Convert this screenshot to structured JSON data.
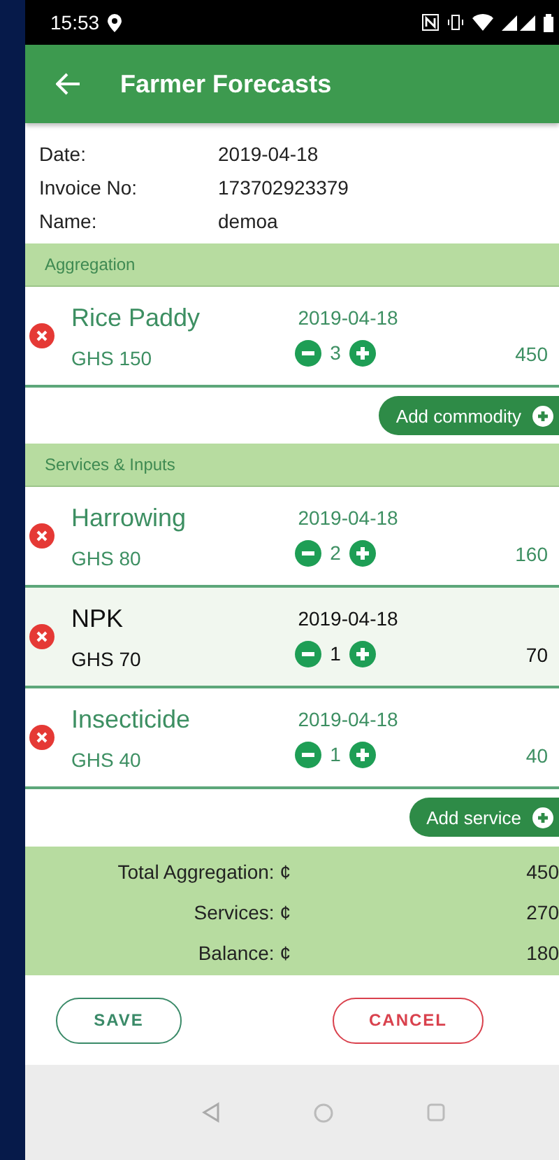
{
  "status_bar": {
    "time": "15:53"
  },
  "app_bar": {
    "title": "Farmer Forecasts"
  },
  "info": [
    {
      "label": "Date:",
      "value": "2019-04-18"
    },
    {
      "label": "Invoice No:",
      "value": "173702923379"
    },
    {
      "label": "Name:",
      "value": "demoa"
    }
  ],
  "aggregation": {
    "header": "Aggregation",
    "items": [
      {
        "name": "Rice Paddy",
        "price": "GHS 150",
        "date": "2019-04-18",
        "quantity": "3",
        "amount": "450",
        "highlighted": false
      }
    ],
    "add_button": "Add commodity"
  },
  "services": {
    "header": "Services & Inputs",
    "items": [
      {
        "name": "Harrowing",
        "price": "GHS 80",
        "date": "2019-04-18",
        "quantity": "2",
        "amount": "160",
        "highlighted": false
      },
      {
        "name": "NPK",
        "price": "GHS 70",
        "date": "2019-04-18",
        "quantity": "1",
        "amount": "70",
        "highlighted": true
      },
      {
        "name": "Insecticide",
        "price": "GHS 40",
        "date": "2019-04-18",
        "quantity": "1",
        "amount": "40",
        "highlighted": false
      }
    ],
    "add_button": "Add service"
  },
  "totals": [
    {
      "label": "Total Aggregation: ¢",
      "value": "450"
    },
    {
      "label": "Services: ¢",
      "value": "270"
    },
    {
      "label": "Balance: ¢",
      "value": "180"
    }
  ],
  "buttons": {
    "save": "SAVE",
    "cancel": "CANCEL"
  }
}
